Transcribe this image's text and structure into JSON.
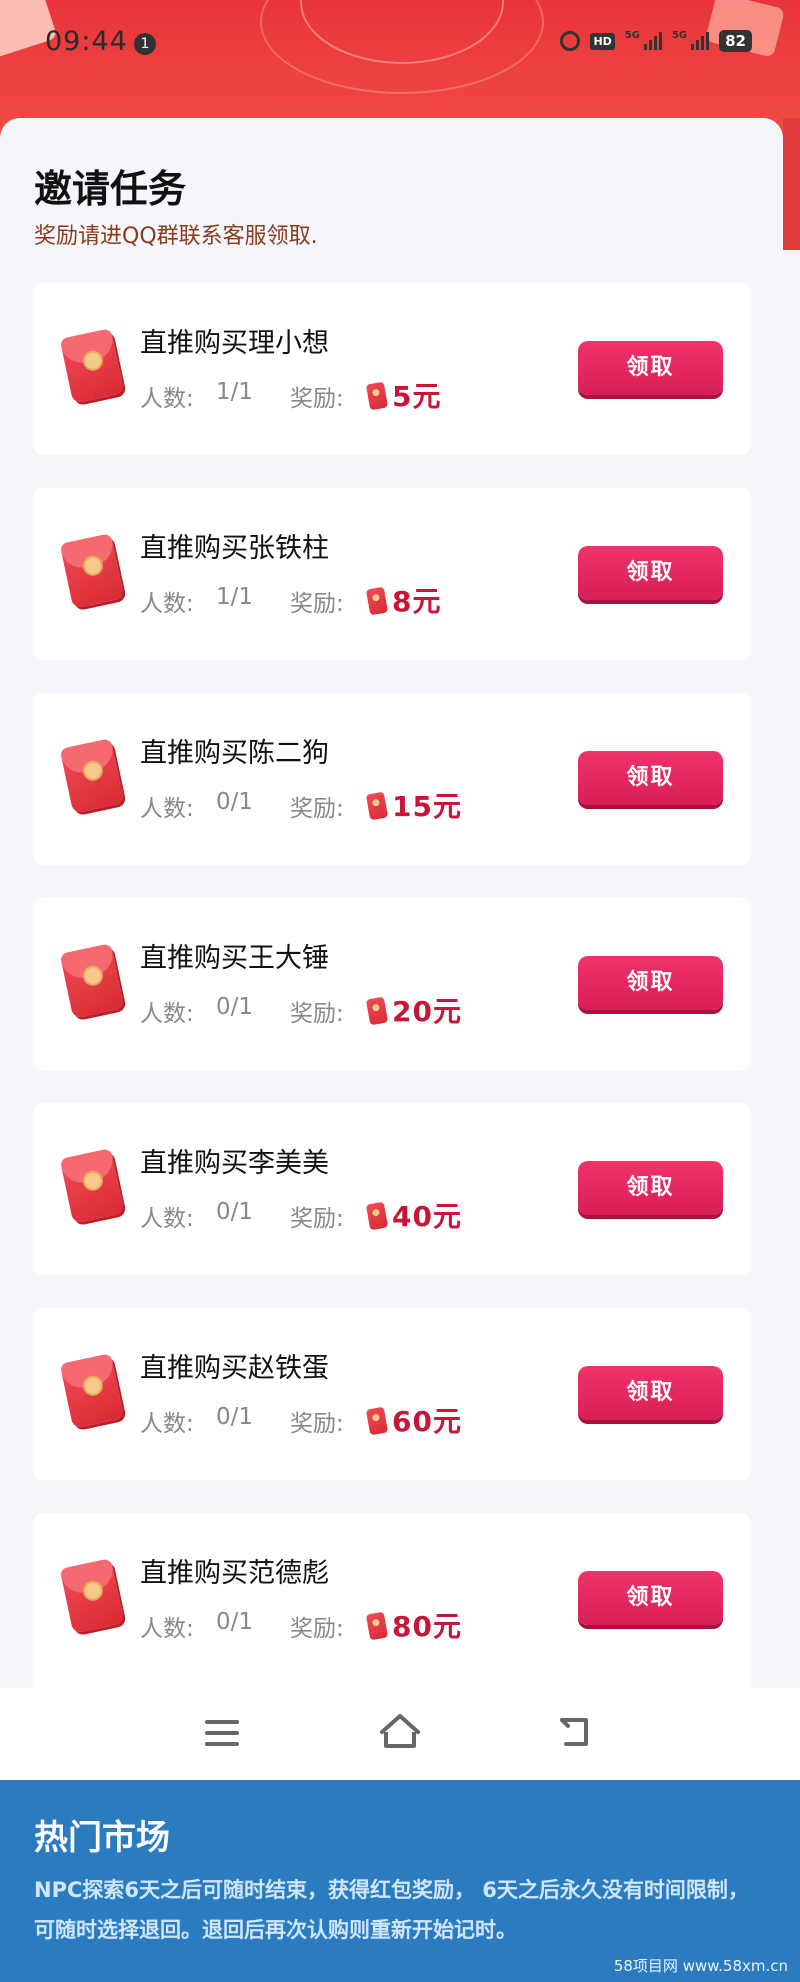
{
  "status_bar": {
    "time": "09:44",
    "notification_count": "1",
    "hd_label": "HD",
    "signal_label_1": "5G",
    "signal_label_2": "5G",
    "battery": "82"
  },
  "section": {
    "title": "邀请任务",
    "subtitle": "奖励请进QQ群联系客服领取."
  },
  "labels": {
    "count_label": "人数:",
    "reward_label": "奖励:",
    "claim_button": "领取"
  },
  "tasks": [
    {
      "name": "直推购买理小想",
      "count": "1/1",
      "reward": "5元"
    },
    {
      "name": "直推购买张铁柱",
      "count": "1/1",
      "reward": "8元"
    },
    {
      "name": "直推购买陈二狗",
      "count": "0/1",
      "reward": "15元"
    },
    {
      "name": "直推购买王大锤",
      "count": "0/1",
      "reward": "20元"
    },
    {
      "name": "直推购买李美美",
      "count": "0/1",
      "reward": "40元"
    },
    {
      "name": "直推购买赵铁蛋",
      "count": "0/1",
      "reward": "60元"
    },
    {
      "name": "直推购买范德彪",
      "count": "0/1",
      "reward": "80元"
    }
  ],
  "nav": {
    "menu_icon": "menu-icon",
    "home_icon": "home-icon",
    "back_icon": "back-icon"
  },
  "footer": {
    "title": "热门市场",
    "text": "NPC探索6天之后可随时结束，获得红包奖励， 6天之后永久没有时间限制，可随时选择退回。退回后再次认购则重新开始记时。",
    "watermark": "58项目网 www.58xm.cn"
  },
  "colors": {
    "header_red": "#e8343a",
    "button_pink": "#e0285e",
    "reward_red": "#c8153a",
    "footer_blue": "#2a7bbf"
  }
}
